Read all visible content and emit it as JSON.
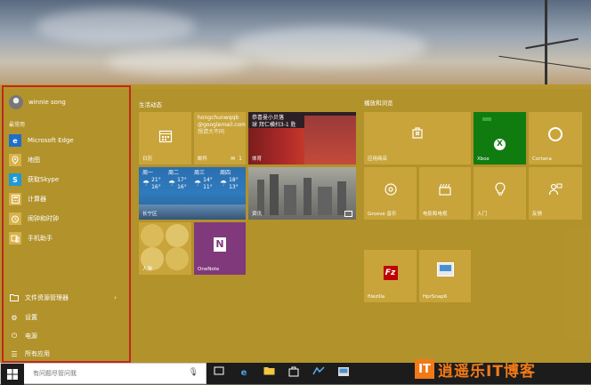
{
  "left": {
    "user_name": "winnie song",
    "most_used_label": "最常用",
    "items": [
      {
        "label": "Microsoft Edge",
        "icon": "edge-icon",
        "color": "#1e6fc8"
      },
      {
        "label": "地图",
        "icon": "maps-icon",
        "color": "#c9a43a"
      },
      {
        "label": "获取Skype",
        "icon": "skype-icon",
        "color": "#1e9ad6"
      },
      {
        "label": "计算器",
        "icon": "calculator-icon",
        "color": "#c9a43a"
      },
      {
        "label": "闹钟和时钟",
        "icon": "alarm-icon",
        "color": "#c9a43a"
      },
      {
        "label": "手机助手",
        "icon": "phone-companion-icon",
        "color": "#c9a43a"
      }
    ],
    "system": [
      {
        "label": "文件资源管理器",
        "icon": "folder-icon"
      },
      {
        "label": "设置",
        "icon": "gear-icon"
      },
      {
        "label": "电源",
        "icon": "power-icon"
      },
      {
        "label": "所有应用",
        "icon": "list-icon"
      }
    ]
  },
  "groups": {
    "life": "生活动态",
    "play": "播放和浏览"
  },
  "tiles": {
    "calendar": "日历",
    "mail": {
      "label": "邮件",
      "sender": "hongchunwqqb",
      "email": "@googlemail.com",
      "subject": "想请大不同",
      "count": "1"
    },
    "sports": {
      "label": "体育",
      "headline": "恭喜曼小贝落",
      "score": "球 拜仁横扫3-1 胜"
    },
    "weather": {
      "location": "长宁区",
      "days": [
        {
          "day": "周一",
          "hi": "21°",
          "lo": "16°"
        },
        {
          "day": "周二",
          "hi": "17°",
          "lo": "16°"
        },
        {
          "day": "周三",
          "hi": "14°",
          "lo": "11°"
        },
        {
          "day": "周四",
          "hi": "18°",
          "lo": "13°"
        }
      ]
    },
    "news": "资讯",
    "people": "人脉",
    "onenote": "OneNote",
    "store": "应用商店",
    "xbox": "Xbox",
    "cortana": "Cortana",
    "groove": "Groove 音乐",
    "movies": "电影和电视",
    "getstarted": "入门",
    "feedback": "反馈",
    "filezilla": "filezilla",
    "hprsnap": "HprSnap6"
  },
  "taskbar": {
    "search_placeholder": "有问题尽管问我"
  },
  "watermark": {
    "badge": "IT",
    "text": "逍遥乐IT博客"
  },
  "colors": {
    "accent": "#c9a43a",
    "xbox": "#107c10",
    "onenote": "#80397b",
    "weather": "#2a6eb0",
    "highlight": "#c0281e"
  }
}
